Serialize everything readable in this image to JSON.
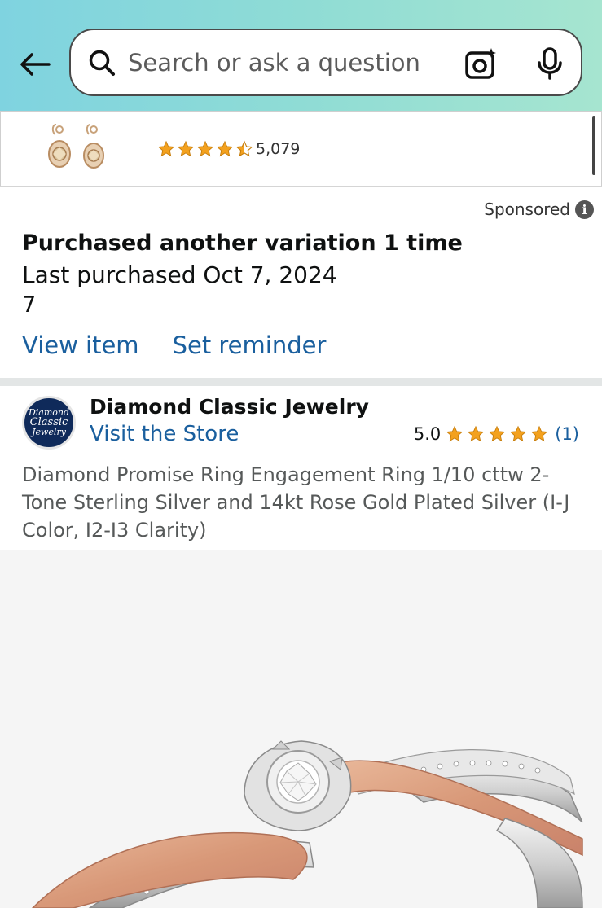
{
  "header": {
    "search_placeholder": "Search or ask a question"
  },
  "ad": {
    "rating_count": "5,079",
    "stars": 4.5,
    "sponsored_label": "Sponsored",
    "info_glyph": "i"
  },
  "purchase": {
    "title": "Purchased another variation 1 time",
    "last_purchased": "Last purchased Oct 7, 2024",
    "quantity": "7",
    "view_item": "View item",
    "set_reminder": "Set reminder"
  },
  "store": {
    "logo_line1": "Diamond",
    "logo_line2": "Classic",
    "logo_line3": "Jewelry",
    "name": "Diamond Classic Jewelry",
    "visit": "Visit the Store",
    "rating": "5.0",
    "rating_count": "(1)"
  },
  "product": {
    "title": "Diamond Promise Ring Engagement Ring 1/10 cttw 2-Tone Sterling Silver and 14kt Rose Gold Plated Silver (I-J Color, I2-I3 Clarity)"
  },
  "colors": {
    "link": "#1a5f9e",
    "star": "#f3a11e",
    "header_gradient_start": "#7fd3e0",
    "header_gradient_end": "#a6e5d0"
  }
}
